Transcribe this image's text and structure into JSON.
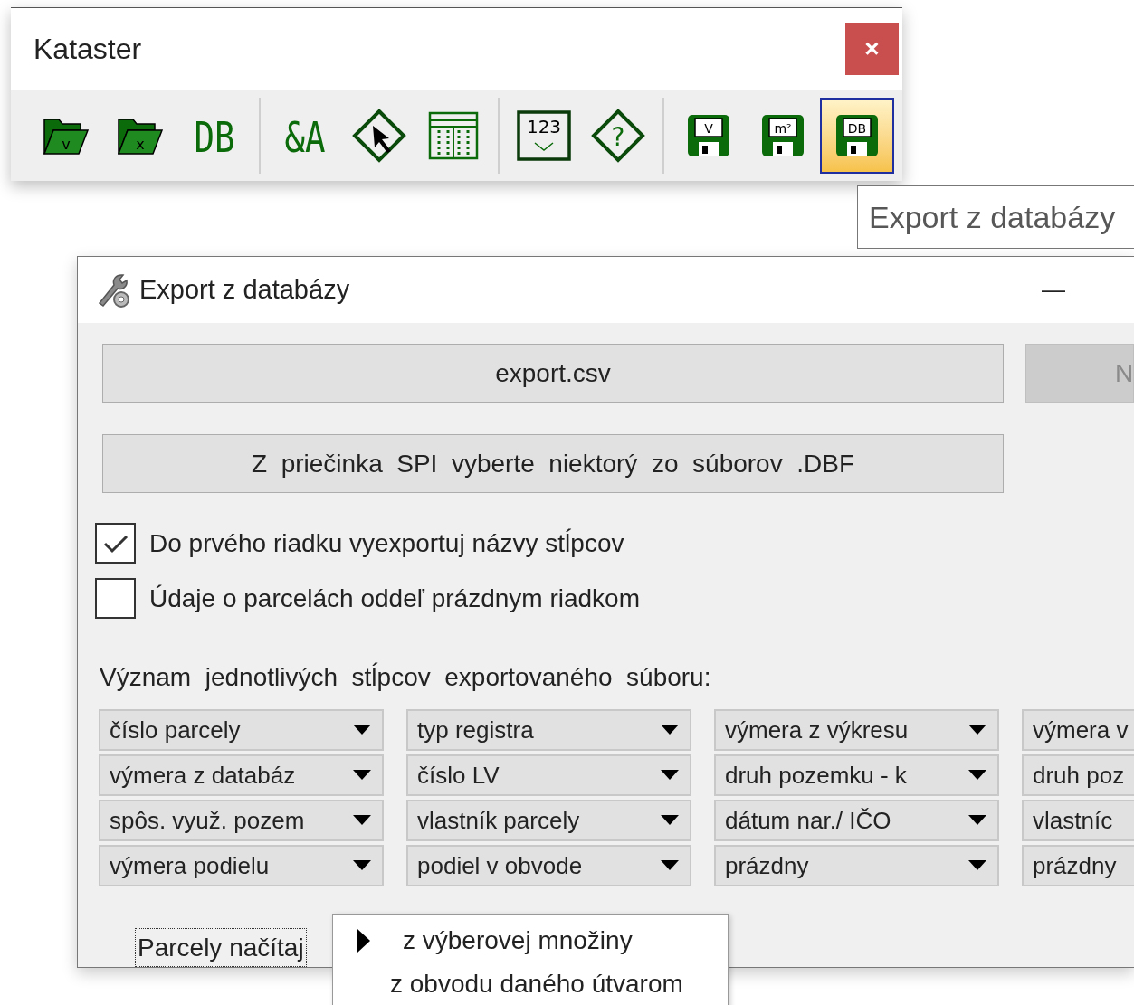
{
  "toolbar_window": {
    "title": "Kataster",
    "close": "×",
    "groups": [
      [
        {
          "kind": "folder",
          "label": "v",
          "selected": false
        },
        {
          "kind": "folder",
          "label": "x",
          "selected": false
        },
        {
          "kind": "text",
          "label": "DB",
          "selected": false
        }
      ],
      [
        {
          "kind": "text",
          "label": "&A",
          "selected": false
        },
        {
          "kind": "diamond-arrow",
          "selected": false
        },
        {
          "kind": "table",
          "selected": false
        }
      ],
      [
        {
          "kind": "numbox",
          "label": "123",
          "selected": false
        },
        {
          "kind": "diamond",
          "label": "?",
          "selected": false
        }
      ],
      [
        {
          "kind": "save",
          "label": "V",
          "selected": false
        },
        {
          "kind": "save",
          "label": "m²",
          "selected": false
        },
        {
          "kind": "save",
          "label": "DB",
          "selected": true
        }
      ]
    ]
  },
  "tooltip": "Export z databázy",
  "dialog": {
    "title": "Export z databázy",
    "minimize": "—",
    "file_button": "export.csv",
    "side_button": {
      "label": "N",
      "disabled": true
    },
    "folder_button": "Z  priečinka  SPI  vyberte  niektorý  zo  súborov  .DBF",
    "checkboxes": [
      {
        "label": "Do prvého riadku vyexportuj názvy stĺpcov",
        "checked": true
      },
      {
        "label": "Údaje o parcelách oddeľ prázdnym riadkom",
        "checked": false
      }
    ],
    "columns_label": "Význam  jednotlivých  stĺpcov  exportovaného  súboru:",
    "column_selects": [
      [
        "číslo parcely",
        "typ registra",
        "výmera z výkresu",
        "výmera v"
      ],
      [
        "výmera z databáz",
        "číslo LV",
        "druh pozemku - k",
        "druh poz"
      ],
      [
        "spôs. využ. pozem",
        "vlastník parcely",
        "dátum nar./ IČO",
        "vlastníc"
      ],
      [
        "výmera podielu",
        "podiel v obvode",
        "prázdny",
        "prázdny"
      ]
    ],
    "load_button": "Parcely načítaj"
  },
  "popup_menu": [
    {
      "label": "z výberovej množiny",
      "selected": true
    },
    {
      "label": "z obvodu daného útvarom",
      "selected": false
    }
  ]
}
